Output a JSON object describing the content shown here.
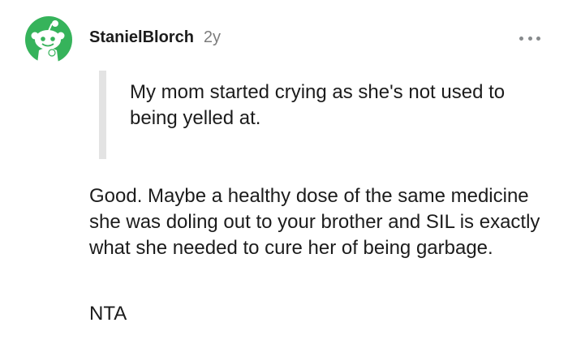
{
  "comment": {
    "author": "StanielBlorch",
    "age": "2y",
    "more_icon": "ellipsis-icon",
    "avatar_icon": "snoo-avatar-icon",
    "quote": "My mom started crying as she's not used to being yelled at.",
    "paragraphs": [
      "Good. Maybe a healthy dose of the same medicine she was doling out to your brother and SIL is exactly what she needed to cure her of being garbage.",
      "NTA"
    ]
  },
  "colors": {
    "avatar_green": "#36b35b",
    "quote_bar": "#e3e3e3",
    "text": "#1c1c1c",
    "meta": "#7c7c7c"
  }
}
